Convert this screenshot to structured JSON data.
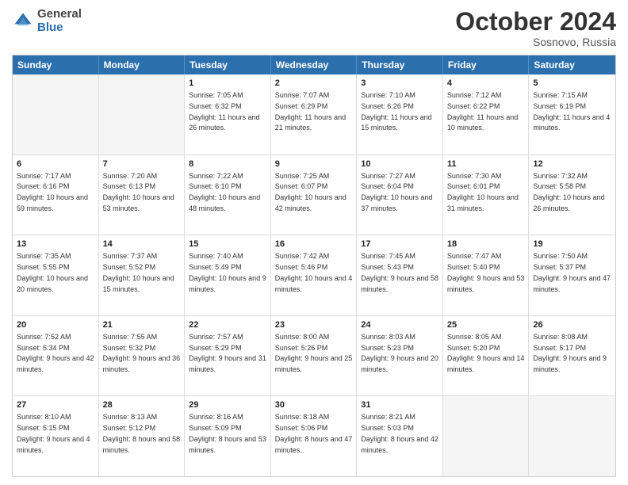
{
  "header": {
    "logo_general": "General",
    "logo_blue": "Blue",
    "month_title": "October 2024",
    "location": "Sosnovo, Russia"
  },
  "weekdays": [
    "Sunday",
    "Monday",
    "Tuesday",
    "Wednesday",
    "Thursday",
    "Friday",
    "Saturday"
  ],
  "rows": [
    [
      {
        "day": "",
        "sunrise": "",
        "sunset": "",
        "daylight": ""
      },
      {
        "day": "",
        "sunrise": "",
        "sunset": "",
        "daylight": ""
      },
      {
        "day": "1",
        "sunrise": "Sunrise: 7:05 AM",
        "sunset": "Sunset: 6:32 PM",
        "daylight": "Daylight: 11 hours and 26 minutes."
      },
      {
        "day": "2",
        "sunrise": "Sunrise: 7:07 AM",
        "sunset": "Sunset: 6:29 PM",
        "daylight": "Daylight: 11 hours and 21 minutes."
      },
      {
        "day": "3",
        "sunrise": "Sunrise: 7:10 AM",
        "sunset": "Sunset: 6:26 PM",
        "daylight": "Daylight: 11 hours and 15 minutes."
      },
      {
        "day": "4",
        "sunrise": "Sunrise: 7:12 AM",
        "sunset": "Sunset: 6:22 PM",
        "daylight": "Daylight: 11 hours and 10 minutes."
      },
      {
        "day": "5",
        "sunrise": "Sunrise: 7:15 AM",
        "sunset": "Sunset: 6:19 PM",
        "daylight": "Daylight: 11 hours and 4 minutes."
      }
    ],
    [
      {
        "day": "6",
        "sunrise": "Sunrise: 7:17 AM",
        "sunset": "Sunset: 6:16 PM",
        "daylight": "Daylight: 10 hours and 59 minutes."
      },
      {
        "day": "7",
        "sunrise": "Sunrise: 7:20 AM",
        "sunset": "Sunset: 6:13 PM",
        "daylight": "Daylight: 10 hours and 53 minutes."
      },
      {
        "day": "8",
        "sunrise": "Sunrise: 7:22 AM",
        "sunset": "Sunset: 6:10 PM",
        "daylight": "Daylight: 10 hours and 48 minutes."
      },
      {
        "day": "9",
        "sunrise": "Sunrise: 7:25 AM",
        "sunset": "Sunset: 6:07 PM",
        "daylight": "Daylight: 10 hours and 42 minutes."
      },
      {
        "day": "10",
        "sunrise": "Sunrise: 7:27 AM",
        "sunset": "Sunset: 6:04 PM",
        "daylight": "Daylight: 10 hours and 37 minutes."
      },
      {
        "day": "11",
        "sunrise": "Sunrise: 7:30 AM",
        "sunset": "Sunset: 6:01 PM",
        "daylight": "Daylight: 10 hours and 31 minutes."
      },
      {
        "day": "12",
        "sunrise": "Sunrise: 7:32 AM",
        "sunset": "Sunset: 5:58 PM",
        "daylight": "Daylight: 10 hours and 26 minutes."
      }
    ],
    [
      {
        "day": "13",
        "sunrise": "Sunrise: 7:35 AM",
        "sunset": "Sunset: 5:55 PM",
        "daylight": "Daylight: 10 hours and 20 minutes."
      },
      {
        "day": "14",
        "sunrise": "Sunrise: 7:37 AM",
        "sunset": "Sunset: 5:52 PM",
        "daylight": "Daylight: 10 hours and 15 minutes."
      },
      {
        "day": "15",
        "sunrise": "Sunrise: 7:40 AM",
        "sunset": "Sunset: 5:49 PM",
        "daylight": "Daylight: 10 hours and 9 minutes."
      },
      {
        "day": "16",
        "sunrise": "Sunrise: 7:42 AM",
        "sunset": "Sunset: 5:46 PM",
        "daylight": "Daylight: 10 hours and 4 minutes."
      },
      {
        "day": "17",
        "sunrise": "Sunrise: 7:45 AM",
        "sunset": "Sunset: 5:43 PM",
        "daylight": "Daylight: 9 hours and 58 minutes."
      },
      {
        "day": "18",
        "sunrise": "Sunrise: 7:47 AM",
        "sunset": "Sunset: 5:40 PM",
        "daylight": "Daylight: 9 hours and 53 minutes."
      },
      {
        "day": "19",
        "sunrise": "Sunrise: 7:50 AM",
        "sunset": "Sunset: 5:37 PM",
        "daylight": "Daylight: 9 hours and 47 minutes."
      }
    ],
    [
      {
        "day": "20",
        "sunrise": "Sunrise: 7:52 AM",
        "sunset": "Sunset: 5:34 PM",
        "daylight": "Daylight: 9 hours and 42 minutes."
      },
      {
        "day": "21",
        "sunrise": "Sunrise: 7:55 AM",
        "sunset": "Sunset: 5:32 PM",
        "daylight": "Daylight: 9 hours and 36 minutes."
      },
      {
        "day": "22",
        "sunrise": "Sunrise: 7:57 AM",
        "sunset": "Sunset: 5:29 PM",
        "daylight": "Daylight: 9 hours and 31 minutes."
      },
      {
        "day": "23",
        "sunrise": "Sunrise: 8:00 AM",
        "sunset": "Sunset: 5:26 PM",
        "daylight": "Daylight: 9 hours and 25 minutes."
      },
      {
        "day": "24",
        "sunrise": "Sunrise: 8:03 AM",
        "sunset": "Sunset: 5:23 PM",
        "daylight": "Daylight: 9 hours and 20 minutes."
      },
      {
        "day": "25",
        "sunrise": "Sunrise: 8:05 AM",
        "sunset": "Sunset: 5:20 PM",
        "daylight": "Daylight: 9 hours and 14 minutes."
      },
      {
        "day": "26",
        "sunrise": "Sunrise: 8:08 AM",
        "sunset": "Sunset: 5:17 PM",
        "daylight": "Daylight: 9 hours and 9 minutes."
      }
    ],
    [
      {
        "day": "27",
        "sunrise": "Sunrise: 8:10 AM",
        "sunset": "Sunset: 5:15 PM",
        "daylight": "Daylight: 9 hours and 4 minutes."
      },
      {
        "day": "28",
        "sunrise": "Sunrise: 8:13 AM",
        "sunset": "Sunset: 5:12 PM",
        "daylight": "Daylight: 8 hours and 58 minutes."
      },
      {
        "day": "29",
        "sunrise": "Sunrise: 8:16 AM",
        "sunset": "Sunset: 5:09 PM",
        "daylight": "Daylight: 8 hours and 53 minutes."
      },
      {
        "day": "30",
        "sunrise": "Sunrise: 8:18 AM",
        "sunset": "Sunset: 5:06 PM",
        "daylight": "Daylight: 8 hours and 47 minutes."
      },
      {
        "day": "31",
        "sunrise": "Sunrise: 8:21 AM",
        "sunset": "Sunset: 5:03 PM",
        "daylight": "Daylight: 8 hours and 42 minutes."
      },
      {
        "day": "",
        "sunrise": "",
        "sunset": "",
        "daylight": ""
      },
      {
        "day": "",
        "sunrise": "",
        "sunset": "",
        "daylight": ""
      }
    ]
  ]
}
